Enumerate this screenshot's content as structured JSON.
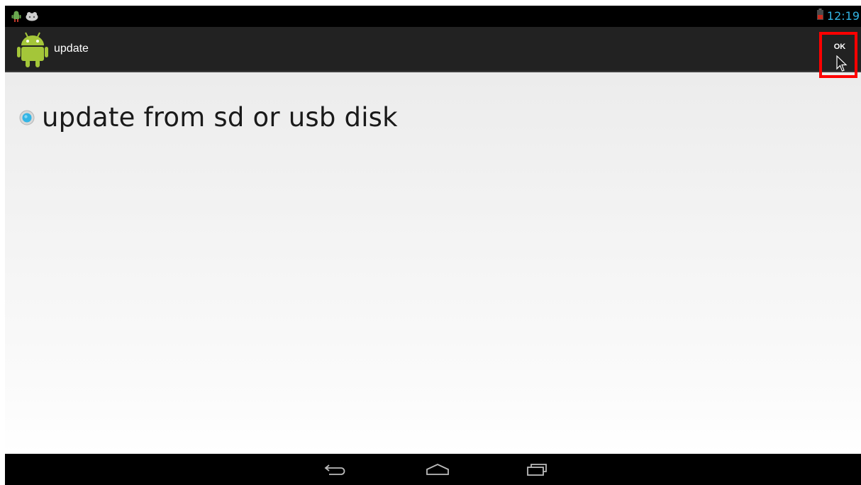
{
  "status_bar": {
    "time": "12:19",
    "left_icons": [
      "android-notification-icon",
      "game-controller-icon"
    ],
    "right_icons": [
      "battery-icon"
    ]
  },
  "action_bar": {
    "title": "update",
    "app_icon": "android-app-icon",
    "ok_label": "OK"
  },
  "content": {
    "options": [
      {
        "label": "update from sd or usb disk",
        "selected": true
      }
    ]
  },
  "navigation_bar": {
    "buttons": [
      "back-icon",
      "home-icon",
      "recents-icon"
    ]
  },
  "colors": {
    "clock": "#33b5e5",
    "radio_selected": "#33b5e5",
    "highlight": "#ff0000",
    "action_bar": "#222222"
  }
}
